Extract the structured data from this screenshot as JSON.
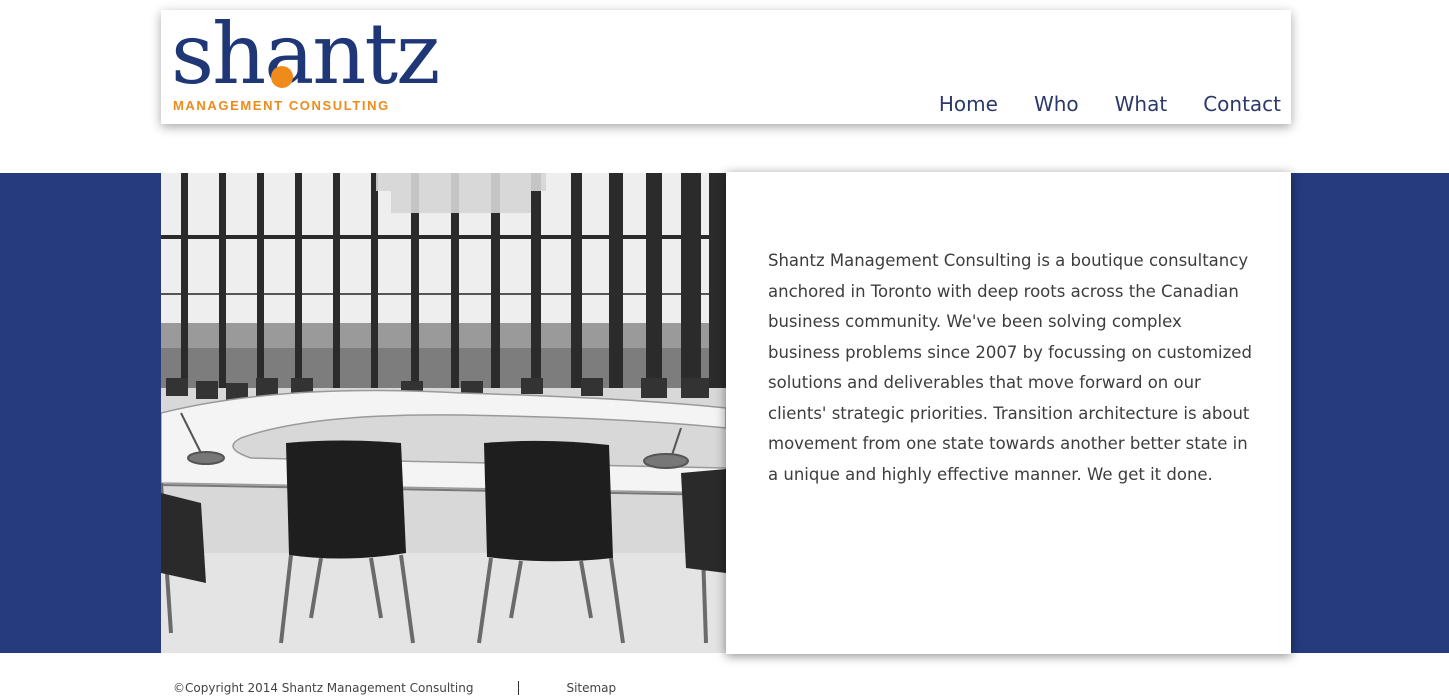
{
  "header": {
    "logo_word": "shantz",
    "logo_subtitle": "Management Consulting"
  },
  "nav": {
    "items": [
      {
        "label": "Home"
      },
      {
        "label": "Who"
      },
      {
        "label": "What"
      },
      {
        "label": "Contact"
      }
    ]
  },
  "main": {
    "body_text": "Shantz Management Consulting is a boutique consultancy anchored in Toronto with deep roots across the Canadian business community. We've been solving complex business problems since 2007 by focussing on customized solutions and deliverables that move forward on our clients' strategic priorities. Transition architecture is about movement from one state towards another better state in a unique and highly effective manner. We get it done."
  },
  "footer": {
    "copyright": "©Copyright 2014 Shantz Management Consulting",
    "sitemap_label": "Sitemap"
  },
  "colors": {
    "brand_blue": "#253b7e",
    "logo_blue": "#1f3677",
    "logo_orange": "#ef8b1b"
  }
}
